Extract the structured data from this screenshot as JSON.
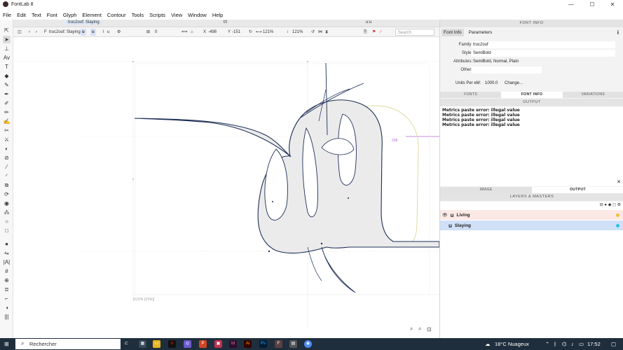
{
  "window": {
    "title": "FontLab 8",
    "minimize": "—",
    "maximize": "☐",
    "close": "✕"
  },
  "menu": [
    "File",
    "Edit",
    "Text",
    "Font",
    "Glyph",
    "Element",
    "Contour",
    "Tools",
    "Scripts",
    "View",
    "Window",
    "Help"
  ],
  "tabs": {
    "active": "truc2ouf: Slaying",
    "center": "t/t",
    "right": "u:u"
  },
  "toolbar": {
    "font_prefix": "F",
    "font_name": "truc2ouf: Slaying",
    "glyph_chip_1": "u",
    "glyph_chip_2": "u",
    "glyph_name": "u",
    "width_value": "0",
    "x_label": "X",
    "x_value": "-498",
    "y_label": "Y",
    "y_value": "-151",
    "w_value": "121%",
    "h_value": "121%",
    "search_placeholder": "Search"
  },
  "canvas": {
    "measure_label": "[121% (21%)]",
    "metric_label": "238"
  },
  "panel": {
    "header": "FONT INFO",
    "subtabs": [
      "Font Info",
      "Parameters"
    ],
    "fields": [
      {
        "label": "Family:",
        "value": "truc2ouf"
      },
      {
        "label": "Style:",
        "value": "SemiBold"
      },
      {
        "label": "Attributes:",
        "value": "SemiBold, Normal, Plain"
      },
      {
        "label": "Other:",
        "value": ""
      }
    ],
    "units_label": "Units Per eM:",
    "units_value": "1000.0",
    "change_label": "Change...",
    "bottom_tabs": [
      "FONTS",
      "FONT INFO",
      "VARIATIONS"
    ],
    "output_header": "OUTPUT",
    "output_lines": [
      "Metrics paste error: illegal value",
      "Metrics paste error: illegal value",
      "Metrics paste error: illegal value",
      "Metrics paste error: illegal value"
    ],
    "image_output_tabs": [
      "IMAGE",
      "OUTPUT"
    ],
    "layers_header": "LAYERS & MASTERS",
    "layers": [
      {
        "name": "Living",
        "glyph": "u",
        "color": "#f0c040"
      },
      {
        "name": "Slaying",
        "glyph": "u",
        "color": "#30c0e0"
      }
    ]
  },
  "taskbar": {
    "search_placeholder": "Rechercher",
    "weather": "18°C Nuageux",
    "time": "17:52"
  }
}
